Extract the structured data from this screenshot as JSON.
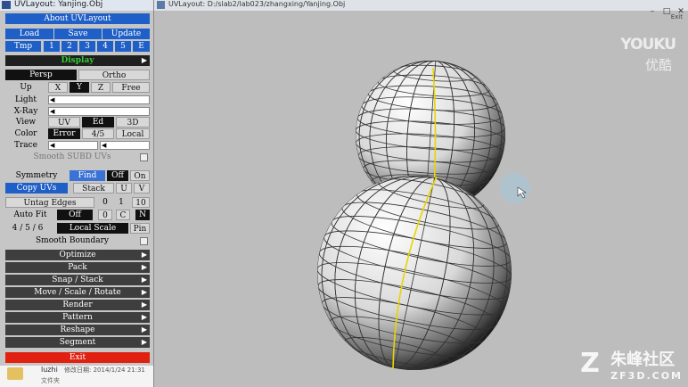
{
  "window": {
    "panel_title": "UVLayout: Yanjing.Obj",
    "view_title": "UVLayout: D:/slab2/lab023/zhangxing/Yanjing.Obj",
    "exit_label": "Exit"
  },
  "panel": {
    "about": "About UVLayout",
    "load": "Load",
    "save": "Save",
    "update": "Update",
    "tmp_label": "Tmp",
    "tmp_slots": [
      "1",
      "2",
      "3",
      "4",
      "5",
      "E"
    ],
    "display": "Display",
    "persp": "Persp",
    "ortho": "Ortho",
    "up_label": "Up",
    "up_axes": [
      "X",
      "Y",
      "Z"
    ],
    "free": "Free",
    "light_label": "Light",
    "xray_label": "X-Ray",
    "view_label": "View",
    "view_modes": [
      "UV",
      "Ed",
      "3D"
    ],
    "color_label": "Color",
    "color_modes": [
      "Error",
      "4/5",
      "Local"
    ],
    "trace_label": "Trace",
    "smooth_subd": "Smooth SUBD UVs",
    "symmetry": "Symmetry",
    "find": "Find",
    "off1": "Off",
    "on": "On",
    "copy_uvs": "Copy UVs",
    "stack": "Stack",
    "u": "U",
    "v": "V",
    "untag_edges": "Untag Edges",
    "untag_vals": [
      "0",
      "1",
      "10"
    ],
    "auto_fit": "Auto Fit",
    "off2": "Off",
    "zero": "0",
    "c": "C",
    "n": "N",
    "ratio": "4 / 5 / 6",
    "local_scale": "Local Scale",
    "pin": "Pin",
    "smooth_boundary": "Smooth Boundary",
    "menus": [
      "Optimize",
      "Pack",
      "Snap / Stack",
      "Move / Scale / Rotate",
      "Render",
      "Pattern",
      "Reshape",
      "Segment"
    ],
    "exit": "Exit"
  },
  "taskbar": {
    "name": "luzhi",
    "date": "修改日期: 2014/1/24 21:31",
    "type": "文件夹"
  },
  "watermarks": {
    "youku_en": "YOUKU",
    "youku_cn": "优酷",
    "zf_cn": "朱峰社区",
    "zf_url": "ZF3D.COM"
  },
  "colors": {
    "blue": "#1f5fc8",
    "red": "#e02010",
    "seam": "#e8d400"
  }
}
